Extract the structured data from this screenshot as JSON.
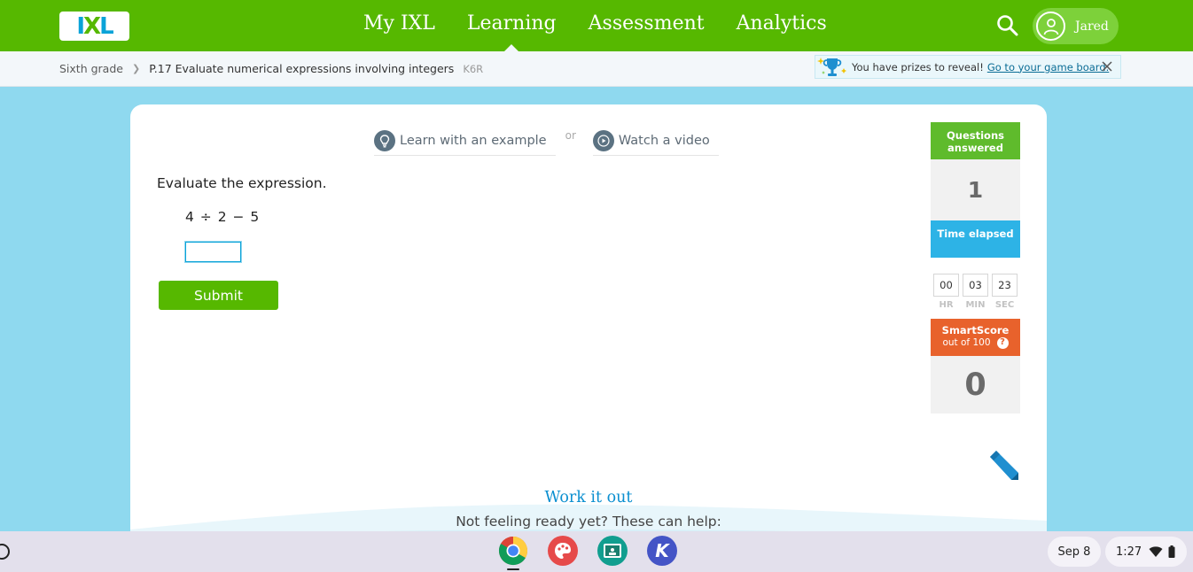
{
  "brand": {
    "logo_parts": [
      "I",
      "X",
      "L"
    ],
    "green": "#56b800",
    "blue": "#0aa3d8"
  },
  "nav": {
    "links": [
      {
        "label": "My IXL",
        "active": false
      },
      {
        "label": "Learning",
        "active": true
      },
      {
        "label": "Assessment",
        "active": false
      },
      {
        "label": "Analytics",
        "active": false
      }
    ],
    "user_name": "Jared",
    "icons": {
      "search": "search-icon",
      "avatar": "user-avatar-icon"
    }
  },
  "breadcrumb": {
    "grade": "Sixth grade",
    "skill": "P.17 Evaluate numerical expressions involving integers",
    "code": "K6R"
  },
  "prize_banner": {
    "text": "You have prizes to reveal!",
    "link": "Go to your game board."
  },
  "help": {
    "example_label": "Learn with an example",
    "or_label": "or",
    "video_label": "Watch a video"
  },
  "question": {
    "prompt": "Evaluate the expression.",
    "expression": "4 ÷ 2 − 5",
    "answer_value": "",
    "submit_label": "Submit"
  },
  "stats": {
    "questions_header": "Questions answered",
    "questions_value": "1",
    "time_header": "Time elapsed",
    "time": {
      "hr": "00",
      "min": "03",
      "sec": "23"
    },
    "time_labels": {
      "hr": "HR",
      "min": "MIN",
      "sec": "SEC"
    },
    "smartscore_header": "SmartScore",
    "smartscore_sub": "out of 100",
    "smartscore_help": "?",
    "smartscore_value": "0",
    "colors": {
      "questions": "#5fbb2c",
      "time": "#2db3e6",
      "smartscore": "#e8622c"
    }
  },
  "work_it_out": {
    "title": "Work it out",
    "subtitle": "Not feeling ready yet? These can help:"
  },
  "taskbar": {
    "apps": [
      "chrome-icon",
      "paint-icon",
      "classroom-icon",
      "kami-icon"
    ],
    "kami_letter": "K",
    "date": "Sep 8",
    "time": "1:27"
  }
}
